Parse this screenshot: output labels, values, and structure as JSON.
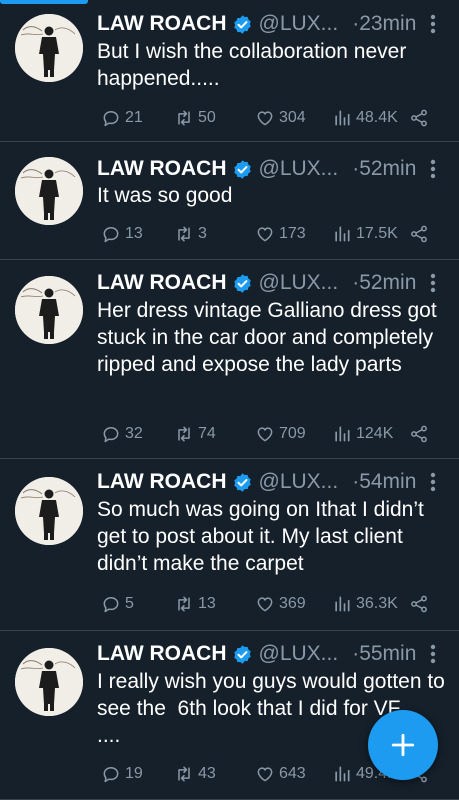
{
  "tweets": [
    {
      "name": "LAW ROACH",
      "handle": "@LUX...",
      "separator": "·",
      "time": "23min",
      "text": "But I wish the collaboration never happened.....",
      "replies": "21",
      "retweets": "50",
      "likes": "304",
      "views": "48.4K"
    },
    {
      "name": "LAW ROACH",
      "handle": "@LUX...",
      "separator": "·",
      "time": "52min",
      "text": "It was so good",
      "replies": "13",
      "retweets": "3",
      "likes": "173",
      "views": "17.5K"
    },
    {
      "name": "LAW ROACH",
      "handle": "@LUX...",
      "separator": "·",
      "time": "52min",
      "text": "Her dress vintage Galliano dress got  stuck in the car door and completely ripped and expose the lady parts",
      "replies": "32",
      "retweets": "74",
      "likes": "709",
      "views": "124K"
    },
    {
      "name": "LAW ROACH",
      "handle": "@LUX...",
      "separator": "·",
      "time": "54min",
      "text": "So much was going on Ithat I didn’t get to post about it. My last client didn’t make the carpet",
      "replies": "5",
      "retweets": "13",
      "likes": "369",
      "views": "36.3K"
    },
    {
      "name": "LAW ROACH",
      "handle": "@LUX...",
      "separator": "·",
      "time": "55min",
      "text": "I really wish you guys would gotten to see the  6th look that I did for VF\n....",
      "replies": "19",
      "retweets": "43",
      "likes": "643",
      "views": "49.4K"
    }
  ],
  "icons": {
    "verified": "verified-badge-icon",
    "more": "more-vertical-icon",
    "reply": "reply-icon",
    "retweet": "retweet-icon",
    "like": "heart-icon",
    "views": "views-bar-chart-icon",
    "share": "share-icon",
    "compose": "plus-icon"
  },
  "colors": {
    "background": "#15202b",
    "accent": "#1d9bf0",
    "muted": "#8b98a5",
    "divider": "#38444d"
  }
}
